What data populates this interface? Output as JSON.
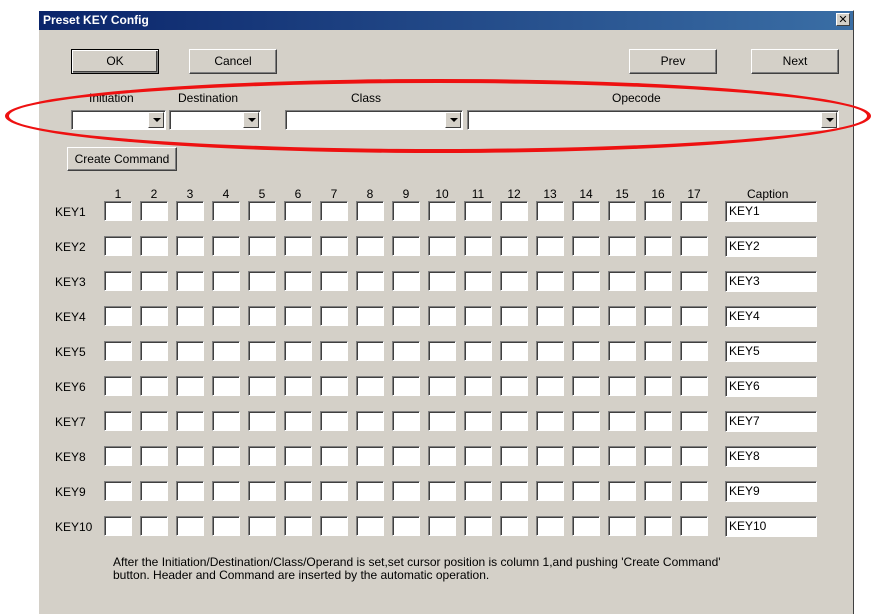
{
  "window": {
    "title": "Preset KEY Config"
  },
  "buttons": {
    "ok": "OK",
    "cancel": "Cancel",
    "prev": "Prev",
    "next": "Next",
    "create_command": "Create Command"
  },
  "fields": {
    "initiation_label": "Initiation",
    "destination_label": "Destination",
    "class_label": "Class",
    "opecode_label": "Opecode"
  },
  "grid": {
    "columns": [
      "1",
      "2",
      "3",
      "4",
      "5",
      "6",
      "7",
      "8",
      "9",
      "10",
      "11",
      "12",
      "13",
      "14",
      "15",
      "16",
      "17"
    ],
    "caption_header": "Caption",
    "rows": [
      {
        "label": "KEY1",
        "caption": "KEY1"
      },
      {
        "label": "KEY2",
        "caption": "KEY2"
      },
      {
        "label": "KEY3",
        "caption": "KEY3"
      },
      {
        "label": "KEY4",
        "caption": "KEY4"
      },
      {
        "label": "KEY5",
        "caption": "KEY5"
      },
      {
        "label": "KEY6",
        "caption": "KEY6"
      },
      {
        "label": "KEY7",
        "caption": "KEY7"
      },
      {
        "label": "KEY8",
        "caption": "KEY8"
      },
      {
        "label": "KEY9",
        "caption": "KEY9"
      },
      {
        "label": "KEY10",
        "caption": "KEY10"
      }
    ]
  },
  "note": "After the Initiation/Destination/Class/Operand is set,set cursor position is column 1,and pushing 'Create Command' button. Header and Command are inserted by the automatic operation.",
  "annotation": {
    "highlight_color": "#ee1111"
  }
}
